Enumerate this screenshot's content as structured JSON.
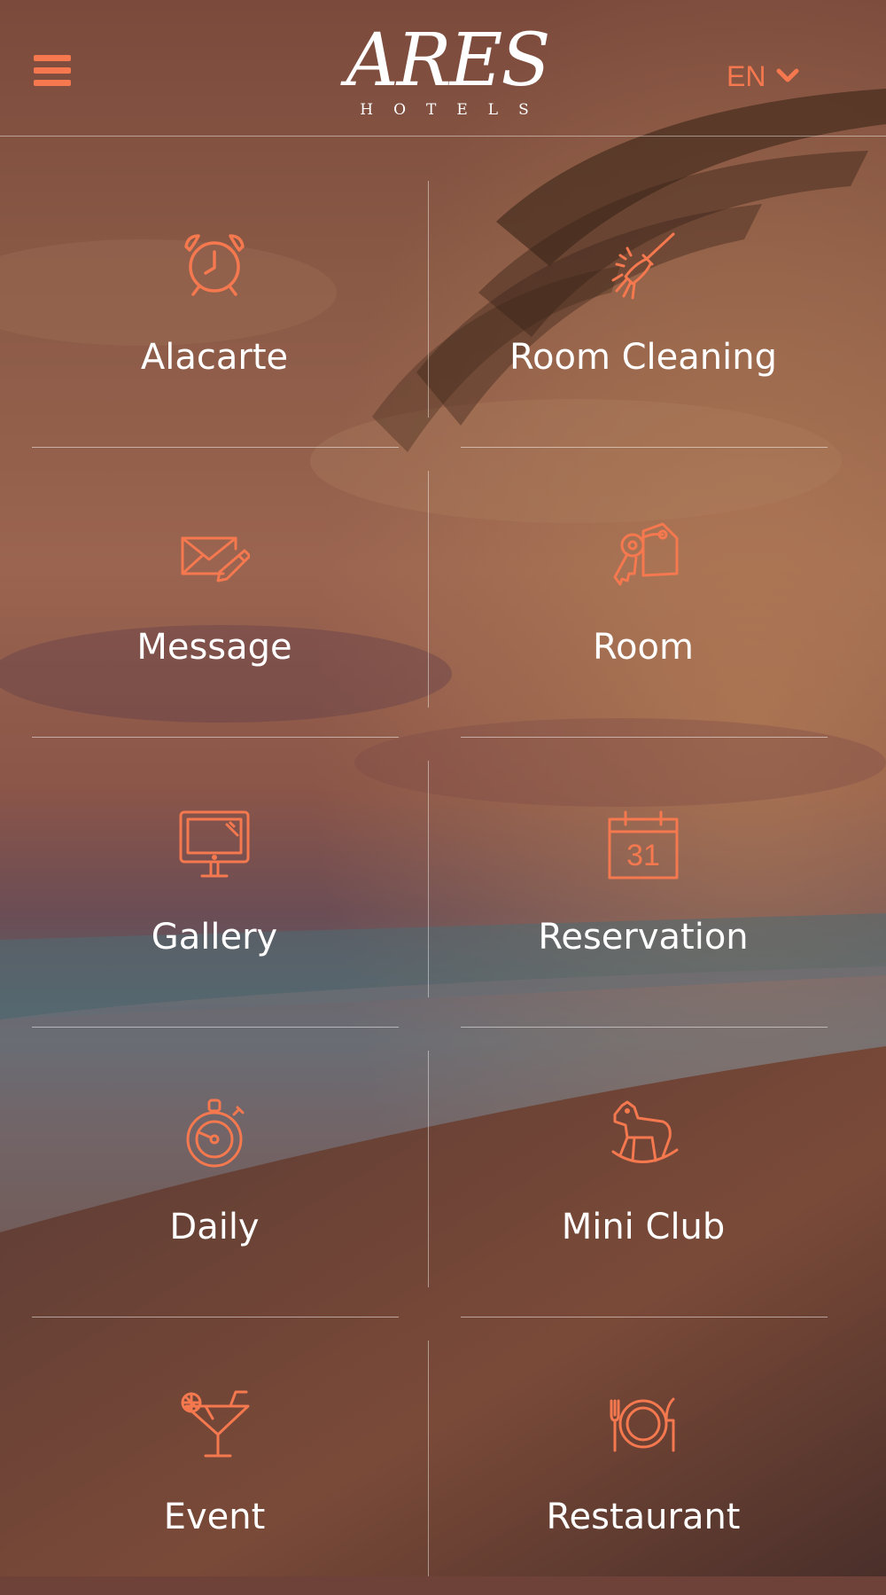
{
  "theme": {
    "accent": "#f5784f",
    "text": "#ffffff"
  },
  "header": {
    "menu_icon": "hamburger-icon",
    "logo": {
      "main": "ARES",
      "sub": "HOTELS"
    },
    "language": {
      "selected": "EN",
      "icon": "chevron-down-icon"
    }
  },
  "tiles": [
    {
      "label": "Alacarte",
      "icon": "alarm-clock-icon"
    },
    {
      "label": "Room Cleaning",
      "icon": "broom-icon"
    },
    {
      "label": "Message",
      "icon": "envelope-pencil-icon"
    },
    {
      "label": "Room",
      "icon": "key-tag-icon"
    },
    {
      "label": "Gallery",
      "icon": "monitor-icon"
    },
    {
      "label": "Reservation",
      "icon": "calendar-icon",
      "icon_text": "31"
    },
    {
      "label": "Daily",
      "icon": "stopwatch-icon"
    },
    {
      "label": "Mini Club",
      "icon": "rocking-horse-icon"
    },
    {
      "label": "Event",
      "icon": "cocktail-icon"
    },
    {
      "label": "Restaurant",
      "icon": "plate-cutlery-icon"
    }
  ]
}
